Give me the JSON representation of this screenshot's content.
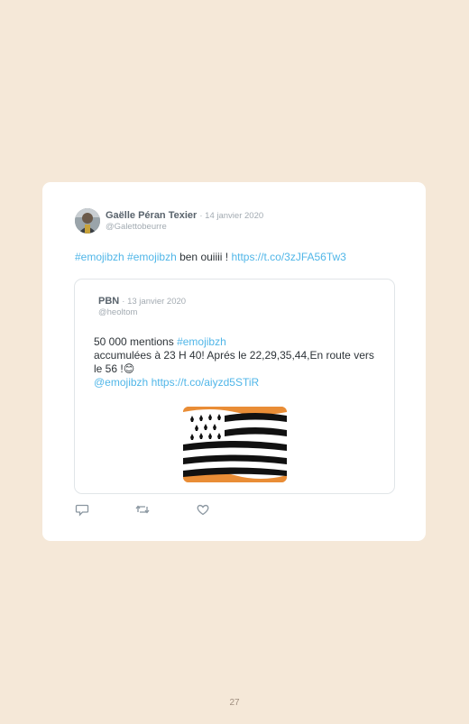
{
  "tweet": {
    "author_name": "Gaëlle Péran Texier",
    "date": "· 14 janvier 2020",
    "handle": "@Galettobeurre",
    "hashtag1": "#emojibzh",
    "hashtag2": "#emojibzh",
    "text": " ben ouiiii ! ",
    "link": "https://t.co/3zJFA56Tw3"
  },
  "quoted": {
    "author_name": "PBN",
    "date": "· 13 janvier 2020",
    "handle": "@heoltom",
    "line1_prefix": "50 000 mentions ",
    "line1_hashtag": "#emojibzh",
    "line2": "accumulées à 23 H 40! Aprés le 22,29,35,44,En route vers le 56 !",
    "emoji": "😊",
    "mention": "@emojibzh",
    "link": "https://t.co/aiyzd5STiR",
    "image_icon": "breton-flag-emoji"
  },
  "actions": {
    "reply_icon": "reply-icon",
    "retweet_icon": "retweet-icon",
    "like_icon": "heart-icon"
  },
  "page_number": "27",
  "colors": {
    "background": "#f5e8d8",
    "card": "#ffffff",
    "link": "#50b6e8",
    "muted": "#a3abb2",
    "flag_orange": "#e98d36"
  }
}
